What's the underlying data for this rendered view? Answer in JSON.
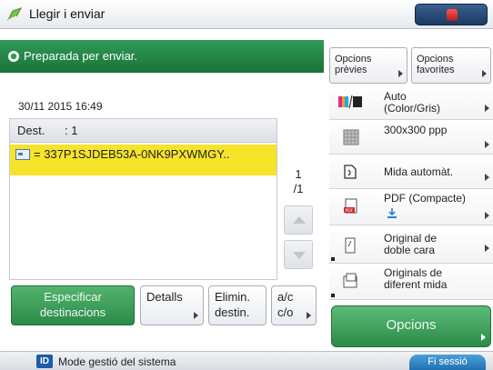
{
  "header": {
    "title": "Llegir i enviar"
  },
  "status": {
    "text": "Preparada per enviar."
  },
  "job": {
    "datetime": "30/11 2015 16:49"
  },
  "destinations": {
    "label": "Dest.",
    "count": ": 1",
    "items": [
      "= 337P1SJDEB53A-0NK9PXWMGY.."
    ],
    "page_current": "1",
    "page_total": "/1"
  },
  "bottom_buttons": {
    "specify_line1": "Especificar",
    "specify_line2": "destinacions",
    "details": "Detalls",
    "delete_line1": "Elimin.",
    "delete_line2": "destin.",
    "cc_line1": "a/c",
    "cc_line2": "c/o"
  },
  "options": {
    "previous_line1": "Opcions",
    "previous_line2": "prèvies",
    "favorites_line1": "Opcions",
    "favorites_line2": "favorites",
    "color_line1": "Auto",
    "color_line2": "(Color/Gris)",
    "resolution": "300x300 ppp",
    "size": "Mida automàt.",
    "format_line1": "PDF (Compacte)",
    "duplex_line1": "Original de",
    "duplex_line2": "doble cara",
    "mixed_line1": "Originals de",
    "mixed_line2": "diferent mida",
    "options_button": "Opcions"
  },
  "footer": {
    "badge": "ID",
    "mode": "Mode gestió del sistema",
    "logout": "Fi sessió"
  }
}
